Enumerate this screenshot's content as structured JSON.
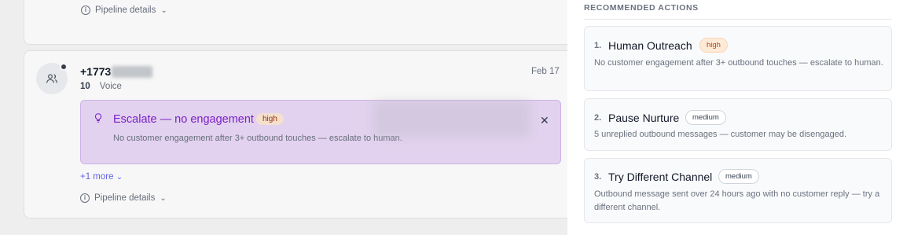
{
  "background": {
    "top_card": {
      "pipeline_label": "Pipeline details"
    },
    "contact": {
      "phone_prefix": "+1773",
      "count": "10",
      "channel": "Voice",
      "date": "Feb 17"
    },
    "alert": {
      "title": "Escalate — no engagement",
      "priority": "high",
      "description": "No customer engagement after 3+ outbound touches — escalate to human."
    },
    "more_link": "+1 more",
    "pipeline_label": "Pipeline details"
  },
  "panel": {
    "header": "RECOMMENDED ACTIONS",
    "actions": [
      {
        "number": "1.",
        "title": "Human Outreach",
        "priority": "high",
        "description": "No customer engagement after 3+ outbound touches — escalate to human."
      },
      {
        "number": "2.",
        "title": "Pause Nurture",
        "priority": "medium",
        "description": "5 unreplied outbound messages — customer may be disengaged."
      },
      {
        "number": "3.",
        "title": "Try Different Channel",
        "priority": "medium",
        "description": "Outbound message sent over 24 hours ago with no customer reply — try a different channel."
      }
    ]
  },
  "colors": {
    "alert_accent": "#7e22ce",
    "link": "#6366f1",
    "high_badge": "#c2410c"
  }
}
